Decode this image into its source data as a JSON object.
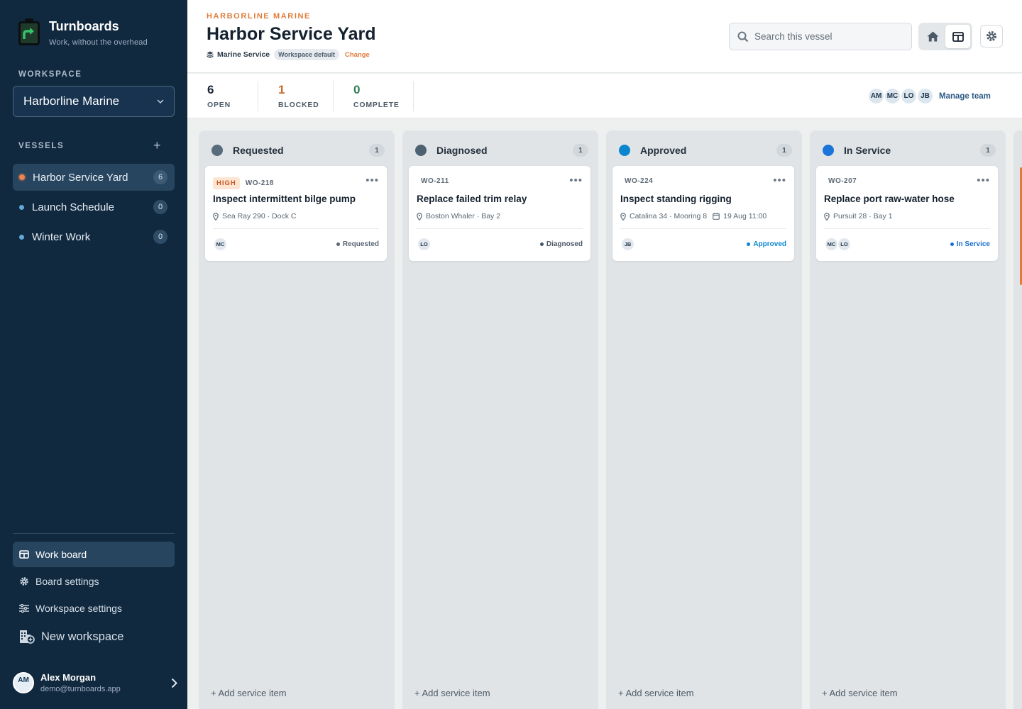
{
  "brand": {
    "name": "Turnboards",
    "tagline": "Work, without the overhead"
  },
  "sidebar": {
    "workspace_label": "WORKSPACE",
    "workspace_selected": "Harborline Marine",
    "vessels_label": "VESSELS",
    "vessels": [
      {
        "name": "Harbor Service Yard",
        "count": "6"
      },
      {
        "name": "Launch Schedule",
        "count": "0"
      },
      {
        "name": "Winter Work",
        "count": "0"
      }
    ],
    "nav": [
      {
        "label": "Work board",
        "icon": "board-icon"
      },
      {
        "label": "Board settings",
        "icon": "gear-icon"
      },
      {
        "label": "Workspace settings",
        "icon": "sliders-icon"
      },
      {
        "label": "New workspace",
        "icon": "building-add-icon"
      }
    ],
    "user": {
      "initials": "AM",
      "name": "Alex Morgan",
      "email": "demo@turnboards.app"
    }
  },
  "header": {
    "org": "HARBORLINE MARINE",
    "title": "Harbor Service Yard",
    "type": "Marine Service",
    "badge": "Workspace default",
    "change": "Change",
    "search_placeholder": "Search this vessel"
  },
  "stats": [
    {
      "value": "6",
      "label": "OPEN",
      "color": "#1c2733"
    },
    {
      "value": "1",
      "label": "BLOCKED",
      "color": "#c96a2c"
    },
    {
      "value": "0",
      "label": "COMPLETE",
      "color": "#2f7d54"
    }
  ],
  "team": {
    "members": [
      "AM",
      "MC",
      "LO",
      "JB"
    ],
    "manage": "Manage team"
  },
  "add_item_label": "+ Add service item",
  "columns": [
    {
      "title": "Requested",
      "count": "1",
      "color": "#586c7c",
      "card": {
        "priority": "HIGH",
        "id": "WO-218",
        "title": "Inspect intermittent bilge pump",
        "location": "Sea Ray 290 · Dock C",
        "date": "",
        "assignees": [
          "MC"
        ],
        "status": "Requested",
        "status_color": "#5a6875"
      }
    },
    {
      "title": "Diagnosed",
      "count": "1",
      "color": "#4e6170",
      "card": {
        "priority": "",
        "id": "WO-211",
        "title": "Replace failed trim relay",
        "location": "Boston Whaler · Bay 2",
        "date": "",
        "assignees": [
          "LO"
        ],
        "status": "Diagnosed",
        "status_color": "#4a5866"
      }
    },
    {
      "title": "Approved",
      "count": "1",
      "color": "#0a86d0",
      "card": {
        "priority": "",
        "id": "WO-224",
        "title": "Inspect standing rigging",
        "location": "Catalina 34 · Mooring 8",
        "date": "19 Aug 11:00",
        "assignees": [
          "JB"
        ],
        "status": "Approved",
        "status_color": "#0a86d0"
      }
    },
    {
      "title": "In Service",
      "count": "1",
      "color": "#1b74d8",
      "card": {
        "priority": "",
        "id": "WO-207",
        "title": "Replace port raw-water hose",
        "location": "Pursuit 28 · Bay 1",
        "date": "",
        "assignees": [
          "MC",
          "LO"
        ],
        "status": "In Service",
        "status_color": "#1b6fcf"
      }
    }
  ]
}
